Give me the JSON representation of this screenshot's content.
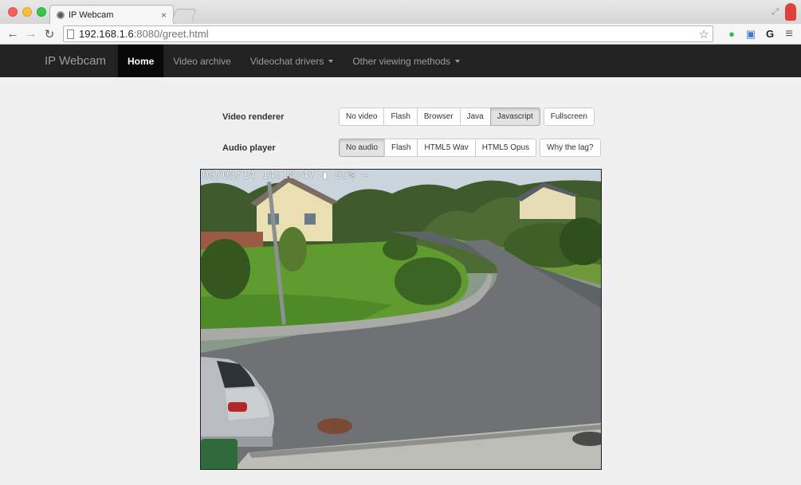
{
  "browser": {
    "tab_title": "IP Webcam",
    "tab_close": "×",
    "url_host": "192.168.1.6",
    "url_rest": ":8080/greet.html"
  },
  "navbar": {
    "brand": "IP Webcam",
    "items": [
      {
        "label": "Home",
        "active": true
      },
      {
        "label": "Video archive"
      },
      {
        "label": "Videochat drivers",
        "dropdown": true
      },
      {
        "label": "Other viewing methods",
        "dropdown": true
      }
    ]
  },
  "video_renderer": {
    "label": "Video renderer",
    "options": [
      "No video",
      "Flash",
      "Browser",
      "Java",
      "Javascript"
    ],
    "selected": "Javascript",
    "extra_button": "Fullscreen"
  },
  "audio_player": {
    "label": "Audio player",
    "options": [
      "No audio",
      "Flash",
      "HTML5 Wav",
      "HTML5 Opus"
    ],
    "selected": "No audio",
    "extra_button": "Why the lag?"
  },
  "video": {
    "overlay_text": "09/08/14 14:18:47 ▮ 95% ⌁"
  }
}
